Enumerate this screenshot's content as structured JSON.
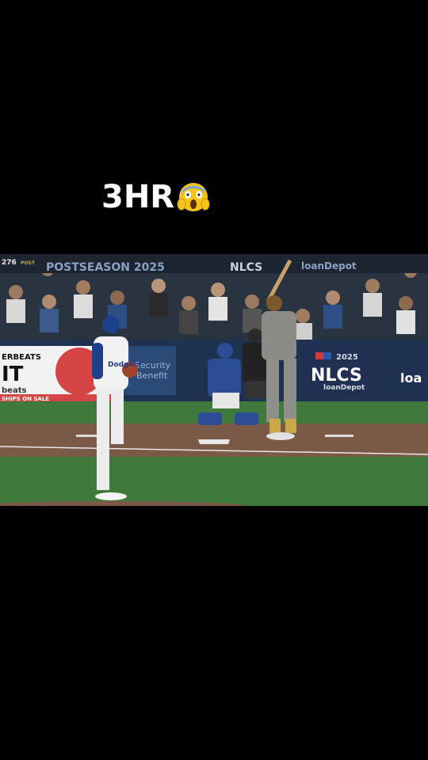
{
  "caption": {
    "text": "3HR",
    "emoji": "face-screaming-in-fear-icon"
  },
  "video": {
    "board_left_number": "276",
    "board_left_tag": "POST",
    "postseason_banner": "POSTSEASON 2025",
    "nlcs_small_banner": "NLCS",
    "loandepot_small_banner": "loanDepot",
    "ad_left_headline": "ERBEATS",
    "ad_left_big": "IT",
    "ad_left_brand": "beats",
    "ad_left_footer": "SHIPS ON SALE",
    "ad_middle_text_1": "Security",
    "ad_middle_text_2": "Benefit",
    "nlcs_year": "2025",
    "nlcs_title": "NLCS",
    "nlcs_sponsor": "loanDepot",
    "ad_right_text": "loa",
    "pitcher_jersey": "Dodgers"
  }
}
